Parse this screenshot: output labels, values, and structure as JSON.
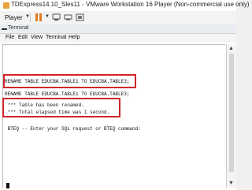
{
  "window": {
    "title": "TDExpress14.10_Sles11 - VMware Workstation 16 Player (Non-commercial use only)"
  },
  "toolbar": {
    "player_label": "Player"
  },
  "terminal": {
    "title": "Terminal"
  },
  "menu": [
    "File",
    "Edit",
    "View",
    "Terminal",
    "Help"
  ],
  "console": {
    "lines": [
      "RENAME TABLE EDUCBA.TABLE1 TO EDUCBA.TABLE3;",
      "RENAME TABLE EDUCBA.TABLE1 TO EDUCBA.TABLE3;",
      " *** Table has been renamed.",
      " *** Total elapsed time was 1 second.",
      " BTEQ -- Enter your SQL request or BTEQ command:"
    ]
  },
  "colors": {
    "highlight": "#d0262a",
    "pause": "#e07a1e"
  }
}
